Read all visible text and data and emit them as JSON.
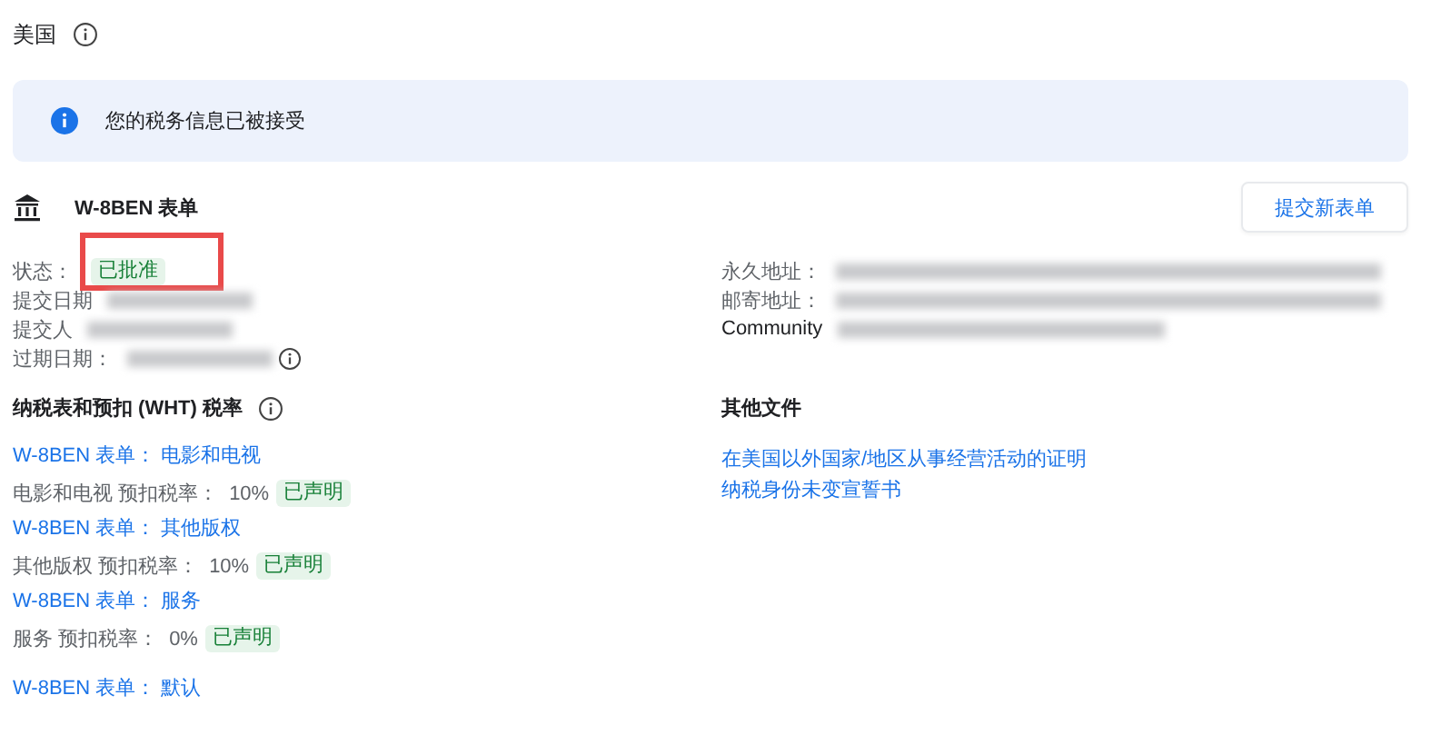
{
  "country": {
    "title": "美国"
  },
  "notice": {
    "text": "您的税务信息已被接受"
  },
  "form": {
    "title": "W-8BEN 表单",
    "button": "提交新表单",
    "left_rows": [
      {
        "label": "状态：",
        "badge": "已批准",
        "blurred": false,
        "info": false,
        "highlighted": true
      },
      {
        "label": "提交日期",
        "blurred": true,
        "info": false,
        "highlighted": false
      },
      {
        "label": "提交人",
        "blurred": true,
        "info": false,
        "highlighted": false
      },
      {
        "label": "过期日期：",
        "blurred": true,
        "info": true,
        "highlighted": false
      }
    ],
    "right_rows": [
      {
        "label": "永久地址：",
        "blurred": true
      },
      {
        "label": "邮寄地址：",
        "blurred": true
      },
      {
        "label": "Community",
        "blurred": true
      }
    ]
  },
  "wht": {
    "title": "纳税表和预扣 (WHT) 税率",
    "groups": [
      {
        "link": "W-8BEN 表单： 电影和电视",
        "rate_label": "电影和电视 预扣税率：",
        "rate": "10%",
        "badge": "已声明"
      },
      {
        "link": "W-8BEN 表单： 其他版权",
        "rate_label": "其他版权 预扣税率：",
        "rate": "10%",
        "badge": "已声明"
      },
      {
        "link": "W-8BEN 表单： 服务",
        "rate_label": "服务 预扣税率：",
        "rate": "0%",
        "badge": "已声明"
      },
      {
        "link": "W-8BEN 表单： 默认"
      }
    ]
  },
  "other_docs": {
    "title": "其他文件",
    "links": [
      "在美国以外国家/地区从事经营活动的证明",
      "纳税身份未变宣誓书"
    ]
  }
}
